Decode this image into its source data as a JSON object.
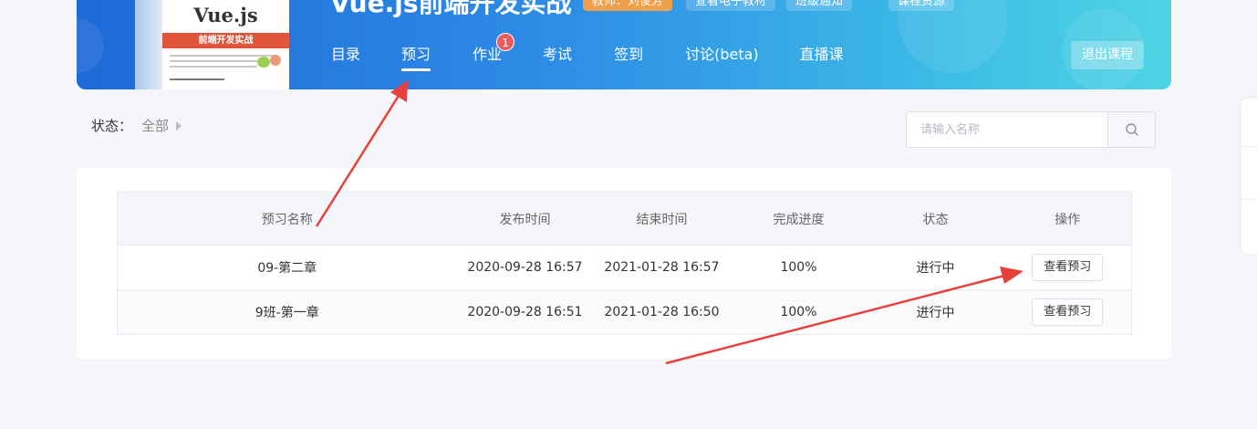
{
  "header": {
    "course_title": "Vue.js前端开发实战",
    "book_cover": {
      "title": "Vue.js",
      "band_text": "前端开发实战"
    },
    "chips": {
      "teacher": "教师：刘俊芳",
      "ebook": "查看电子教材",
      "notice": "班级通知",
      "resources": "课程资源"
    },
    "nav": [
      {
        "label": "目录",
        "active": false
      },
      {
        "label": "预习",
        "active": true
      },
      {
        "label": "作业",
        "active": false,
        "badge": "1"
      },
      {
        "label": "考试",
        "active": false
      },
      {
        "label": "签到",
        "active": false
      },
      {
        "label": "讨论(beta)",
        "active": false
      },
      {
        "label": "直播课",
        "active": false
      }
    ],
    "exit_label": "退出课程"
  },
  "filter": {
    "label": "状态：",
    "value": "全部"
  },
  "search": {
    "placeholder": "请输入名称",
    "icon": "search-icon"
  },
  "table": {
    "columns": [
      "预习名称",
      "发布时间",
      "结束时间",
      "完成进度",
      "状态",
      "操作"
    ],
    "rows": [
      {
        "name": "09-第二章",
        "publish": "2020-09-28 16:57",
        "end": "2021-01-28 16:57",
        "progress": "100%",
        "status": "进行中",
        "action": "查看预习"
      },
      {
        "name": "9班-第一章",
        "publish": "2020-09-28 16:51",
        "end": "2021-01-28 16:50",
        "progress": "100%",
        "status": "进行中",
        "action": "查看预习"
      }
    ]
  },
  "colors": {
    "accent_arrow": "#e8413c",
    "badge": "#f05a5a",
    "teacher_chip": "#f0a04b"
  }
}
